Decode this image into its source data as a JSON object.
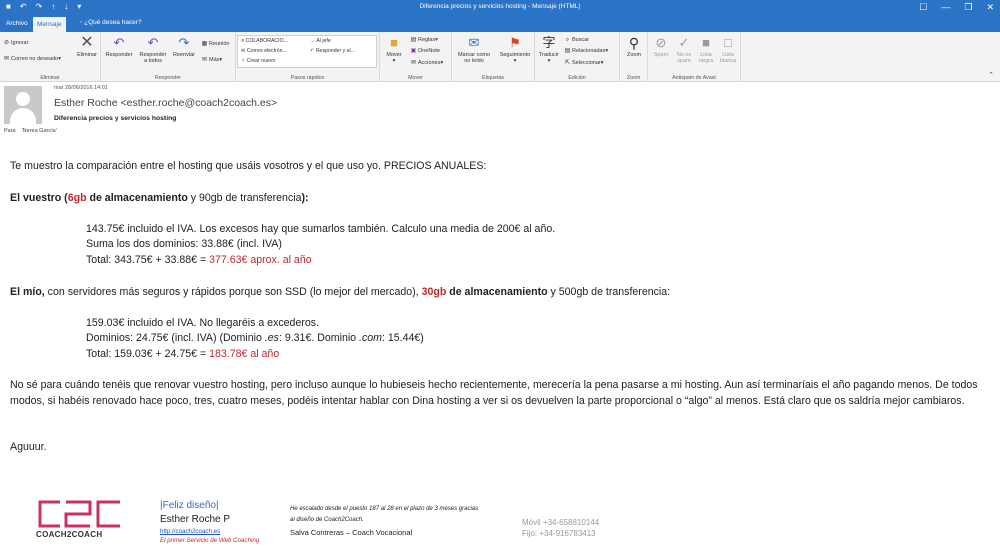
{
  "window": {
    "title": "Diferencia precios y servicios hosting  -  Mensaje (HTML)",
    "qa_icons": [
      "save-icon",
      "undo-icon",
      "redo-icon",
      "up-icon",
      "down-icon",
      "customize-icon"
    ],
    "qa_glyphs": [
      "■",
      "↶",
      "↷",
      "↑",
      "↓",
      "▾"
    ],
    "ctrls": [
      "☐",
      "—",
      "❒",
      "✕"
    ]
  },
  "tabs": {
    "file": "Archivo",
    "message": "Mensaje",
    "tellme": "¿Qué desea hacer?"
  },
  "ribbon": {
    "eliminar": {
      "label": "Eliminar",
      "ignorar": "Ignorar",
      "no_deseado": "Correo no deseado",
      "eliminar": "Eliminar"
    },
    "responder": {
      "label": "Responder",
      "responder": "Responder",
      "responder_todos_1": "Responder",
      "responder_todos_2": "a todos",
      "reenviar": "Reenviar",
      "reunion": "Reunión",
      "mas": "Más"
    },
    "pasos": {
      "label": "Pasos rápidos",
      "q1": "COLABORACIO...",
      "q2": "Al jefe",
      "q3": "Correo electrón...",
      "q4": "Responder y el...",
      "q5": "Crear nuevo"
    },
    "mover": {
      "label": "Mover",
      "mover": "Mover",
      "reglas": "Reglas",
      "onenote": "OneNote",
      "acciones": "Acciones"
    },
    "etiquetas": {
      "label": "Etiquetas",
      "marcar_1": "Marcar como",
      "marcar_2": "no leído",
      "seguimiento": "Seguimiento"
    },
    "edicion": {
      "label": "Edición",
      "traducir": "Traducir",
      "buscar": "Buscar",
      "relacionadas": "Relacionadas",
      "seleccionar": "Seleccionar"
    },
    "zoom": {
      "label": "Zoom",
      "zoom": "Zoom"
    },
    "antispam": {
      "label": "Antispam de Avast",
      "spam": "Spam",
      "noes_1": "No es",
      "noes_2": "spam",
      "negra_1": "Lista",
      "negra_2": "negra",
      "blanca_1": "Lista",
      "blanca_2": "blanca"
    }
  },
  "header": {
    "date": "mar 28/06/2016 14:01",
    "from": "Esther Roche <esther.roche@coach2coach.es>",
    "subject": "Diferencia precios y servicios hosting",
    "to_label": "Para",
    "to_value": "'Nerea García'"
  },
  "body": {
    "intro": "Te muestro la comparación entre el hosting que usáis vosotros y el que uso yo. PRECIOS ANUALES:",
    "yours": {
      "h_a": "El vuestro (",
      "h_b": "6gb",
      "h_c": " de almacenamiento",
      "h_d": " y 90gb de transferencia",
      "h_e": "):",
      "l1": "143.75€ incluido el IVA. Los excesos hay que sumarlos también. Calculo una media de 200€ al año.",
      "l2": "Suma los dos dominios: 33.88€ (incl. IVA)",
      "l3a": "Total: 343.75€ + 33.88€ = ",
      "l3b": "377.63€ aprox. al año"
    },
    "mine": {
      "h_a": "El mío,",
      "h_b": " con servidores más seguros y rápidos porque son SSD (lo mejor del mercado), ",
      "h_c": "30gb",
      "h_d": " de almacenamiento",
      "h_e": " y 500gb de transferencia:",
      "l1": "159.03€ incluido el IVA. No llegaréis a excederos.",
      "l2a": "Dominios: 24.75€ (incl. IVA) (Dominio ",
      "l2b": ".es",
      "l2c": ": 9.31€. Dominio ",
      "l2d": ".com",
      "l2e": ": 15.44€)",
      "l3a": "Total: 159.03€ + 24.75€ = ",
      "l3b": "183.78€ al año"
    },
    "para": "No sé para cuándo tenéis que renovar vuestro hosting, pero incluso aunque lo hubieseis hecho recientemente, merecería la pena pasarse a mi hosting. Aun así terminaríais el año pagando menos. De todos modos, si habéis renovado hace poco, tres, cuatro meses, podéis intentar hablar con Dina hosting a ver si os devuelven la parte proporcional o “algo” al menos. Está claro que os saldría mejor cambiaros.",
    "closing": "Aguuur."
  },
  "signature": {
    "logo_text": "COACH2COACH",
    "tagline": "|Feliz diseño|",
    "name": "Esther Roche P",
    "url": "http://coach2coach.es",
    "slogan": "El primer Servicio de Web Coaching",
    "quote_1": "He escalado desde el puesto 187 al 28 en el plazo de 3 meses gracias",
    "quote_2": "al diseño de Coach2Coach.",
    "quote_author": "Salva Contreras – Coach Vocacional",
    "mobile": "Móvil +34-658810144",
    "fixed": "Fijo: +34-916783413"
  },
  "colors": {
    "accent": "#2b73c5",
    "highlight_red": "#c0282b",
    "logo_pink": "#c8306a"
  }
}
